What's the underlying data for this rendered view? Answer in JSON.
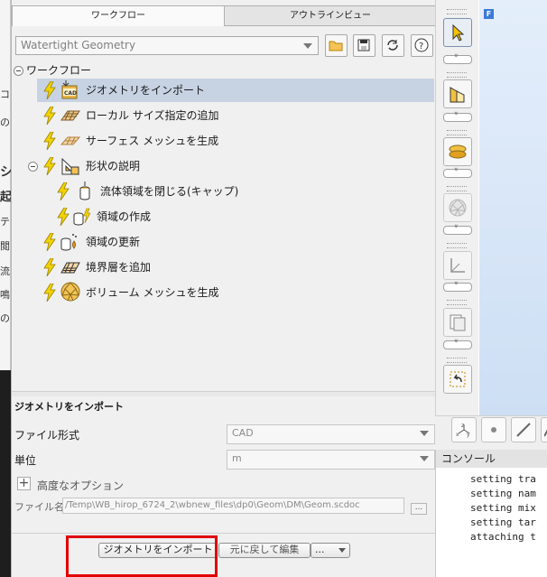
{
  "tabs": {
    "workflow": "ワークフロー",
    "outline": "アウトラインビュー"
  },
  "workflow_dropdown": {
    "value": "Watertight Geometry"
  },
  "toolbar_icons": [
    "open-folder-icon",
    "save-icon",
    "refresh-icon",
    "help-icon"
  ],
  "tree": {
    "root": "ワークフロー",
    "items": [
      {
        "label": "ジオメトリをインポート",
        "icon": "cad-import-icon",
        "selected": true
      },
      {
        "label": "ローカル サイズ指定の追加",
        "icon": "local-sizing-icon"
      },
      {
        "label": "サーフェス メッシュを生成",
        "icon": "surface-mesh-icon"
      },
      {
        "label": "形状の説明",
        "icon": "describe-geometry-icon"
      },
      {
        "label": "流体領域を閉じる(キャップ)",
        "icon": "cap-icon"
      },
      {
        "label": "領域の作成",
        "icon": "create-region-icon"
      },
      {
        "label": "領域の更新",
        "icon": "update-region-icon"
      },
      {
        "label": "境界層を追加",
        "icon": "boundary-layer-icon"
      },
      {
        "label": "ボリューム メッシュを生成",
        "icon": "volume-mesh-icon"
      }
    ]
  },
  "properties": {
    "title": "ジオメトリをインポート",
    "file_format_label": "ファイル形式",
    "file_format_value": "CAD",
    "units_label": "単位",
    "units_value": "m",
    "advanced_label": "高度なオプション",
    "file_name_label": "ファイル名",
    "file_name_value": "/Temp\\WB_hirop_6724_2\\wbnew_files\\dp0\\Geom\\DM\\Geom.scdoc",
    "browse": "..."
  },
  "buttons": {
    "import": "ジオメトリをインポート",
    "revert": "元に戻して編集",
    "more": "..."
  },
  "graphics_badge": "F",
  "console": {
    "title": "コンソール",
    "lines": [
      "setting tra",
      "setting nam",
      "setting mix",
      "setting tar",
      "attaching t"
    ]
  },
  "left_peek": [
    "コ",
    "の",
    "シ",
    "起",
    "テ",
    "閲",
    "流",
    "鳴",
    "の"
  ],
  "colors": {
    "selection": "#c7d3e3",
    "bolt": "#f2d300",
    "highlight_box": "#e00000"
  }
}
